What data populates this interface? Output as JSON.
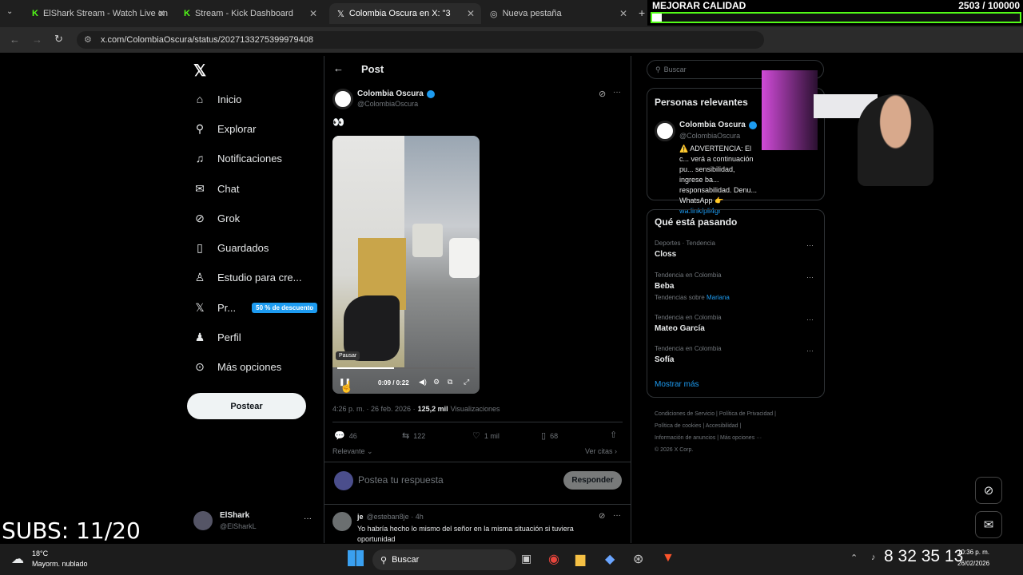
{
  "browser": {
    "tabs": [
      {
        "label": "ElShark Stream - Watch Live on"
      },
      {
        "label": "Stream - Kick Dashboard"
      },
      {
        "label": "Colombia Oscura en X: \"3"
      },
      {
        "label": "Nueva pestaña"
      }
    ],
    "url": "x.com/ColombiaOscura/status/2027133275399979408"
  },
  "overlay": {
    "quality_label": "MEJORAR CALIDAD",
    "quality_count": "2503 / 100000",
    "subs": "SUBS: 11/20"
  },
  "nav": {
    "items": [
      {
        "label": "Inicio",
        "icon": "home-icon"
      },
      {
        "label": "Explorar",
        "icon": "search-icon"
      },
      {
        "label": "Notificaciones",
        "icon": "bell-icon"
      },
      {
        "label": "Chat",
        "icon": "mail-icon"
      },
      {
        "label": "Grok",
        "icon": "grok-icon"
      },
      {
        "label": "Guardados",
        "icon": "bookmark-icon"
      },
      {
        "label": "Estudio para cre...",
        "icon": "studio-icon"
      },
      {
        "label": "Pr...",
        "icon": "x-icon"
      },
      {
        "label": "Perfil",
        "icon": "person-icon"
      },
      {
        "label": "Más opciones",
        "icon": "more-icon"
      }
    ],
    "premium_badge": "50 % de descuento",
    "post_button": "Postear",
    "account_name": "ElShark",
    "account_handle": "@ElSharkL"
  },
  "post": {
    "header": "Post",
    "author": "Colombia Oscura",
    "handle": "@ColombiaOscura",
    "text": "👀",
    "video_tooltip": "Pausar",
    "video_time": "0:09 / 0:22",
    "video_progress": 0.41,
    "meta_time": "4:26 p. m. · 26 feb. 2026 ·",
    "views_count": "125,2 mil",
    "views_label": "Visualizaciones",
    "replies": "46",
    "reposts": "122",
    "likes": "1 mil",
    "bookmarks": "68",
    "sort": "Relevante",
    "quotes": "Ver citas",
    "reply_placeholder": "Postea tu respuesta",
    "reply_button": "Responder"
  },
  "reply": {
    "author": "je",
    "handle": "@esteban8je · 4h",
    "text": "Yo habría hecho lo mismo del señor en la misma situación si tuviera oportunidad"
  },
  "sidebar": {
    "search_placeholder": "Buscar",
    "relevant_title": "Personas relevantes",
    "relevant_name": "Colombia Oscura",
    "relevant_handle": "@ColombiaOscura",
    "relevant_bio": "⚠️ ADVERTENCIA: El c... verá a continuación pu... sensibilidad, ingrese ba... responsabilidad. Denu... WhatsApp 👉",
    "relevant_link": "wa.link/pli4gr",
    "trends_title": "Qué está pasando",
    "trends": [
      {
        "context": "Deportes · Tendencia",
        "name": "Closs"
      },
      {
        "context": "Tendencia en Colombia",
        "name": "Beba",
        "extra": "Tendencias sobre",
        "extra_link": "Mariana"
      },
      {
        "context": "Tendencia en Colombia",
        "name": "Mateo García"
      },
      {
        "context": "Tendencia en Colombia",
        "name": "Sofía"
      }
    ],
    "show_more": "Mostrar más",
    "footer": [
      "Condiciones de Servicio",
      "Política de Privacidad",
      "Política de cookies",
      "Accesibilidad",
      "Información de anuncios",
      "Más opciones ···",
      "© 2026 X Corp."
    ]
  },
  "taskbar": {
    "weather_temp": "18°C",
    "weather_desc": "Mayorm. nublado",
    "search": "Buscar",
    "time": "10:36 p. m.",
    "date": "26/02/2026",
    "counter": "8 32 35 13"
  }
}
